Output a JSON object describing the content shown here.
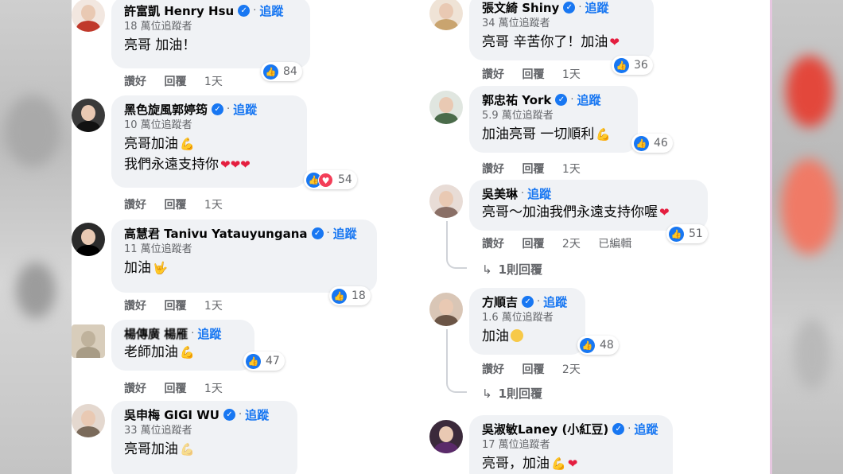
{
  "left_comments": [
    {
      "name": "許富凱 Henry Hsu",
      "follow": "追蹤",
      "followers": "18 萬位追蹤者",
      "lines": [
        "亮哥 加油！"
      ],
      "reaction_count": "84",
      "actions": {
        "like": "讚好",
        "reply": "回覆",
        "time": "1天"
      }
    },
    {
      "name": "黑色旋風郭婷筠",
      "follow": "追蹤",
      "followers": "10 萬位追蹤者",
      "lines": [
        "亮哥加油",
        "我們永遠支持你"
      ],
      "reaction_count": "54",
      "actions": {
        "like": "讚好",
        "reply": "回覆",
        "time": "1天"
      }
    },
    {
      "name": "高慧君 Tanivu Yatauyungana",
      "follow": "追蹤",
      "followers": "11 萬位追蹤者",
      "lines": [
        "加油"
      ],
      "reaction_count": "18",
      "actions": {
        "like": "讚好",
        "reply": "回覆",
        "time": "1天"
      }
    },
    {
      "name": "楊傳廣 楊雁",
      "follow": "追蹤",
      "followers": "",
      "lines": [
        "老師加油"
      ],
      "reaction_count": "47",
      "actions": {
        "like": "讚好",
        "reply": "回覆",
        "time": "1天"
      }
    },
    {
      "name": "吳申梅 GIGI WU",
      "follow": "追蹤",
      "followers": "33 萬位追蹤者",
      "lines": [
        "亮哥加油"
      ],
      "reaction_count": "",
      "actions": {
        "like": "",
        "reply": "",
        "time": ""
      }
    }
  ],
  "right_comments": [
    {
      "name": "張文綺 Shiny",
      "follow": "追蹤",
      "followers": "34 萬位追蹤者",
      "lines": [
        "亮哥 辛苦你了！加油"
      ],
      "reaction_count": "36",
      "actions": {
        "like": "讚好",
        "reply": "回覆",
        "time": "1天"
      }
    },
    {
      "name": "郭忠祐 York",
      "follow": "追蹤",
      "followers": "5.9 萬位追蹤者",
      "lines": [
        "加油亮哥 一切順利"
      ],
      "reaction_count": "46",
      "actions": {
        "like": "讚好",
        "reply": "回覆",
        "time": "1天"
      }
    },
    {
      "name": "吳美琳",
      "follow": "追蹤",
      "followers": "",
      "lines": [
        "亮哥～加油我們永遠支持你喔"
      ],
      "reaction_count": "51",
      "actions": {
        "like": "讚好",
        "reply": "回覆",
        "time": "2天",
        "edited": "已編輯"
      },
      "replies": "1則回覆"
    },
    {
      "name": "方順吉",
      "follow": "追蹤",
      "followers": "1.6 萬位追蹤者",
      "lines": [
        "加油"
      ],
      "reaction_count": "48",
      "actions": {
        "like": "讚好",
        "reply": "回覆",
        "time": "2天"
      },
      "replies": "1則回覆"
    },
    {
      "name": "吳淑敏Laney (小紅豆)",
      "follow": "追蹤",
      "followers": "17 萬位追蹤者",
      "lines": [
        "亮哥，加油"
      ],
      "reaction_count": "",
      "actions": {
        "like": "",
        "reply": "",
        "time": ""
      }
    }
  ],
  "icons": {
    "verified": "verified-badge-icon",
    "like": "like-thumb-icon",
    "love": "love-heart-icon",
    "reply_arrow": "reply-arrow-icon"
  },
  "colors": {
    "bubble": "#f0f2f5",
    "link_blue": "#1877f2",
    "meta_gray": "#65676b"
  }
}
